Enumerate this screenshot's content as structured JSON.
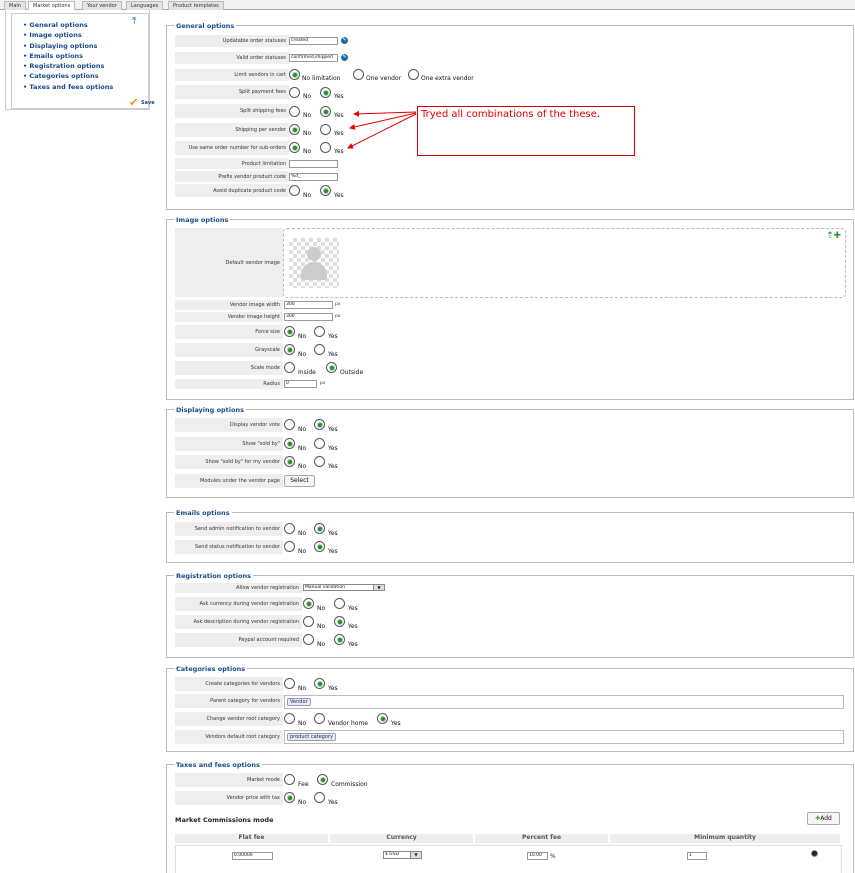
{
  "tabs": [
    "Main",
    "Market options",
    "Your vendor",
    "Languages",
    "Product templates"
  ],
  "sidebar": {
    "items": [
      "General options",
      "Image options",
      "Displaying options",
      "Emails options",
      "Registration options",
      "Categories options",
      "Taxes and fees options"
    ],
    "save_label": "Save"
  },
  "general": {
    "legend": "General options",
    "updatable_label": "Updatable order statuses",
    "updatable_value": "created",
    "valid_label": "Valid order statuses",
    "valid_value": "confirmed,shipped",
    "limit_label": "Limit vendors in cart",
    "limit_opts": [
      "No limitation",
      "One vendor",
      "One extra vendor"
    ],
    "split_payment_label": "Split payment fees",
    "split_shipping_label": "Split shipping fees",
    "shipping_per_vendor_label": "Shipping per vendor",
    "same_order_label": "Use same order number for sub-orders",
    "product_limitation_label": "Product limitation",
    "prefix_label": "Prefix vendor product code",
    "prefix_value": "%d_",
    "avoid_dup_label": "Avoid duplicate product code",
    "no": "No",
    "yes": "Yes"
  },
  "annotation": "Tryed all combinations of the these.",
  "image": {
    "legend": "Image options",
    "default_label": "Default vendor image",
    "width_label": "Vendor image width",
    "width_value": "300",
    "height_label": "Vendor image height",
    "height_value": "300",
    "px": "px",
    "force_label": "Force size",
    "grayscale_label": "Grayscale",
    "scale_label": "Scale mode",
    "inside": "Inside",
    "outside": "Outside",
    "radius_label": "Radius",
    "radius_value": "0"
  },
  "displaying": {
    "legend": "Displaying options",
    "vote_label": "Display vendor vote",
    "sold_by_label": "Show \"sold by\"",
    "sold_by_vendor_label": "Show \"sold by\" for my vendor",
    "modules_label": "Modules under the vendor page",
    "select_label": "Select"
  },
  "emails": {
    "legend": "Emails options",
    "admin_label": "Send admin notification to vendor",
    "status_label": "Send status notification to vendor"
  },
  "registration": {
    "legend": "Registration options",
    "allow_label": "Allow vendor registration",
    "allow_value": "Manual validation",
    "currency_label": "Ask currency during vendor registration",
    "description_label": "Ask description during vendor registration",
    "paypal_label": "Paypal account required"
  },
  "categories": {
    "legend": "Categories options",
    "create_label": "Create categories for vendors",
    "parent_label": "Parent category for vendors",
    "parent_value": "Vendor",
    "root_label": "Change vendor root category",
    "vendor_home": "Vendor home",
    "default_root_label": "Vendors default root category",
    "default_root_value": "product category"
  },
  "taxes": {
    "legend": "Taxes and fees options",
    "market_mode_label": "Market mode",
    "fee": "Fee",
    "commission": "Commission",
    "price_tax_label": "Vendor price with tax",
    "commissions_title": "Market Commissions mode",
    "add_label": "Add",
    "headers": [
      "Flat fee",
      "Currency",
      "Percent fee",
      "Minimum quantity"
    ],
    "flat_fee_value": "0.00000",
    "currency_value": "$ USD",
    "percent_value": "10.00",
    "percent_sign": "%",
    "min_qty_value": "1"
  },
  "colors": {
    "accent": "#1a4b8c",
    "annotation": "#e00000",
    "radio_on": "#2d8b2d"
  }
}
